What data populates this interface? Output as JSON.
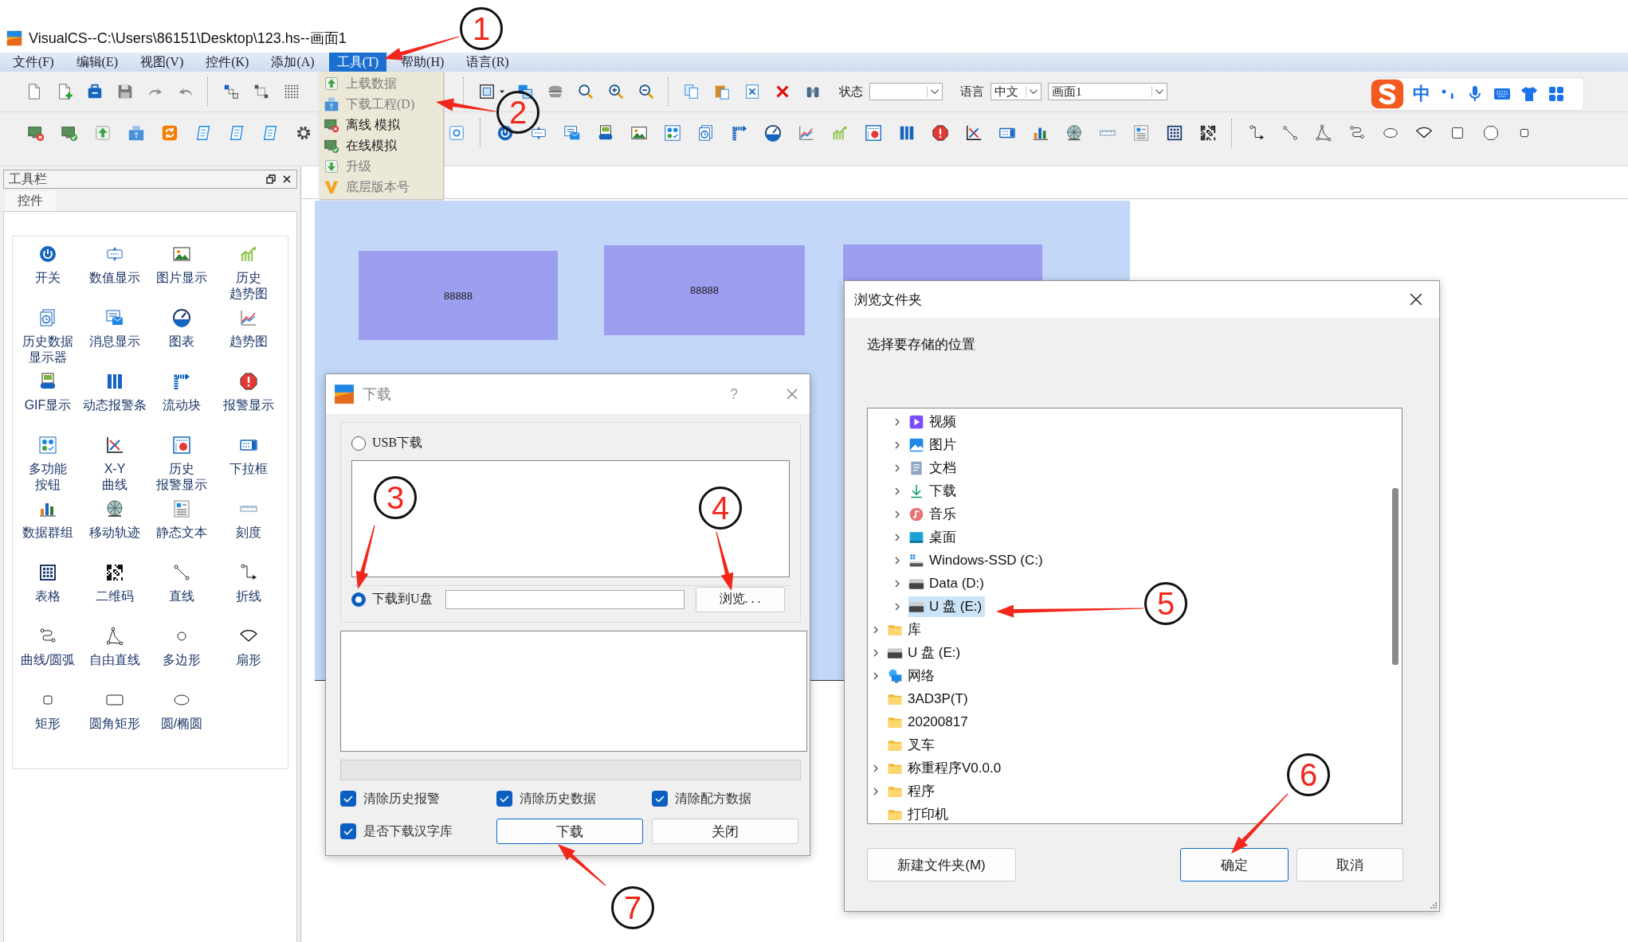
{
  "window": {
    "title": "VisualCS--C:\\Users\\86151\\Desktop\\123.hs--画面1"
  },
  "menu": [
    {
      "label": "文件(F)",
      "selected": false
    },
    {
      "label": "编辑(E)",
      "selected": false
    },
    {
      "label": "视图(V)",
      "selected": false
    },
    {
      "label": "控件(K)",
      "selected": false
    },
    {
      "label": "添加(A)",
      "selected": false
    },
    {
      "label": "工具(T)",
      "selected": true
    },
    {
      "label": "帮助(H)",
      "selected": false
    },
    {
      "label": "语言(R)",
      "selected": false
    }
  ],
  "tools_menu": [
    {
      "label": "上载数据",
      "disabled": true
    },
    {
      "label": "下载工程(D)",
      "disabled": true
    },
    {
      "label": "离线 模拟",
      "disabled": false
    },
    {
      "label": "在线模拟",
      "disabled": false
    },
    {
      "label": "升级",
      "disabled": true
    },
    {
      "label": "底层版本号",
      "disabled": true
    }
  ],
  "toolbar": {
    "status_label": "状态",
    "language_label": "语言",
    "language_value": "中文",
    "page_value": "画面1"
  },
  "ime_bar": {
    "mode": "中"
  },
  "toolbox": {
    "title": "工具栏",
    "tabs": [
      {
        "label": "控件",
        "selected": true
      }
    ],
    "items": [
      {
        "lines": [
          "开关"
        ]
      },
      {
        "lines": [
          "数值显示"
        ]
      },
      {
        "lines": [
          "图片显示"
        ]
      },
      {
        "lines": [
          "历史",
          "趋势图"
        ]
      },
      {
        "lines": [
          "历史数据",
          "显示器"
        ]
      },
      {
        "lines": [
          "消息显示"
        ]
      },
      {
        "lines": [
          "图表"
        ]
      },
      {
        "lines": [
          "趋势图"
        ]
      },
      {
        "lines": [
          "GIF显示"
        ]
      },
      {
        "lines": [
          "动态报警条"
        ]
      },
      {
        "lines": [
          "流动块"
        ]
      },
      {
        "lines": [
          "报警显示"
        ]
      },
      {
        "lines": [
          "多功能",
          "按钮"
        ]
      },
      {
        "lines": [
          "X-Y",
          "曲线"
        ]
      },
      {
        "lines": [
          "历史",
          "报警显示"
        ]
      },
      {
        "lines": [
          "下拉框"
        ]
      },
      {
        "lines": [
          "数据群组"
        ]
      },
      {
        "lines": [
          "移动轨迹"
        ]
      },
      {
        "lines": [
          "静态文本"
        ]
      },
      {
        "lines": [
          "刻度"
        ]
      },
      {
        "lines": [
          "表格"
        ]
      },
      {
        "lines": [
          "二维码"
        ]
      },
      {
        "lines": [
          "直线"
        ]
      },
      {
        "lines": [
          "折线"
        ]
      },
      {
        "lines": [
          "曲线/圆弧"
        ]
      },
      {
        "lines": [
          "自由直线"
        ]
      },
      {
        "lines": [
          "多边形"
        ]
      },
      {
        "lines": [
          "扇形"
        ]
      },
      {
        "lines": [
          "矩形"
        ]
      },
      {
        "lines": [
          "圆角矩形"
        ]
      },
      {
        "lines": [
          "圆/椭圆"
        ]
      }
    ]
  },
  "canvas": {
    "blocks": [
      {
        "text": "88888"
      },
      {
        "text": "88888"
      }
    ]
  },
  "download_dialog": {
    "title": "下载",
    "help": "?",
    "targets": [
      {
        "label": "USB下载",
        "selected": false
      },
      {
        "label": "下载到U盘",
        "selected": true
      }
    ],
    "browse_button": "浏览. . .",
    "progress": {
      "level": 0
    },
    "options": [
      {
        "label": "清除历史报警",
        "checked": true
      },
      {
        "label": "清除历史数据",
        "checked": true
      },
      {
        "label": "清除配方数据",
        "checked": true
      },
      {
        "label": "是否下载汉字库",
        "checked": true
      }
    ],
    "buttons": [
      {
        "label": "下载",
        "default": true
      },
      {
        "label": "关闭",
        "default": false
      }
    ]
  },
  "folder_dialog": {
    "title": "浏览文件夹",
    "prompt": "选择要存储的位置",
    "tree": {
      "nested_items": [
        {
          "label": "视频",
          "expandable": true,
          "selected": false
        },
        {
          "label": "图片",
          "expandable": true,
          "selected": false
        },
        {
          "label": "文档",
          "expandable": true,
          "selected": false
        },
        {
          "label": "下载",
          "expandable": true,
          "selected": false
        },
        {
          "label": "音乐",
          "expandable": true,
          "selected": false
        },
        {
          "label": "桌面",
          "expandable": true,
          "selected": false
        },
        {
          "label": "Windows-SSD (C:)",
          "expandable": true,
          "selected": false
        },
        {
          "label": "Data (D:)",
          "expandable": true,
          "selected": false
        },
        {
          "label": "U 盘 (E:)",
          "expandable": true,
          "selected": true
        }
      ],
      "items": [
        {
          "label": "库",
          "expandable": true,
          "selected": false
        },
        {
          "label": "U 盘 (E:)",
          "expandable": true,
          "selected": false
        },
        {
          "label": "网络",
          "expandable": true,
          "selected": false
        },
        {
          "label": "3AD3P(T)",
          "expandable": false,
          "selected": false
        },
        {
          "label": "20200817",
          "expandable": false,
          "selected": false
        },
        {
          "label": "叉车",
          "expandable": false,
          "selected": false
        },
        {
          "label": "称重程序V0.0.0",
          "expandable": true,
          "selected": false
        },
        {
          "label": "程序",
          "expandable": true,
          "selected": false
        },
        {
          "label": "打印机",
          "expandable": false,
          "selected": false
        }
      ]
    },
    "buttons": [
      {
        "label": "新建文件夹(M)",
        "default": false
      },
      {
        "label": "确定",
        "default": true
      },
      {
        "label": "取消",
        "default": false
      }
    ]
  },
  "annotations": [
    {
      "label": "1"
    },
    {
      "label": "2"
    },
    {
      "label": "3"
    },
    {
      "label": "4"
    },
    {
      "label": "5"
    },
    {
      "label": "6"
    },
    {
      "label": "7"
    }
  ]
}
